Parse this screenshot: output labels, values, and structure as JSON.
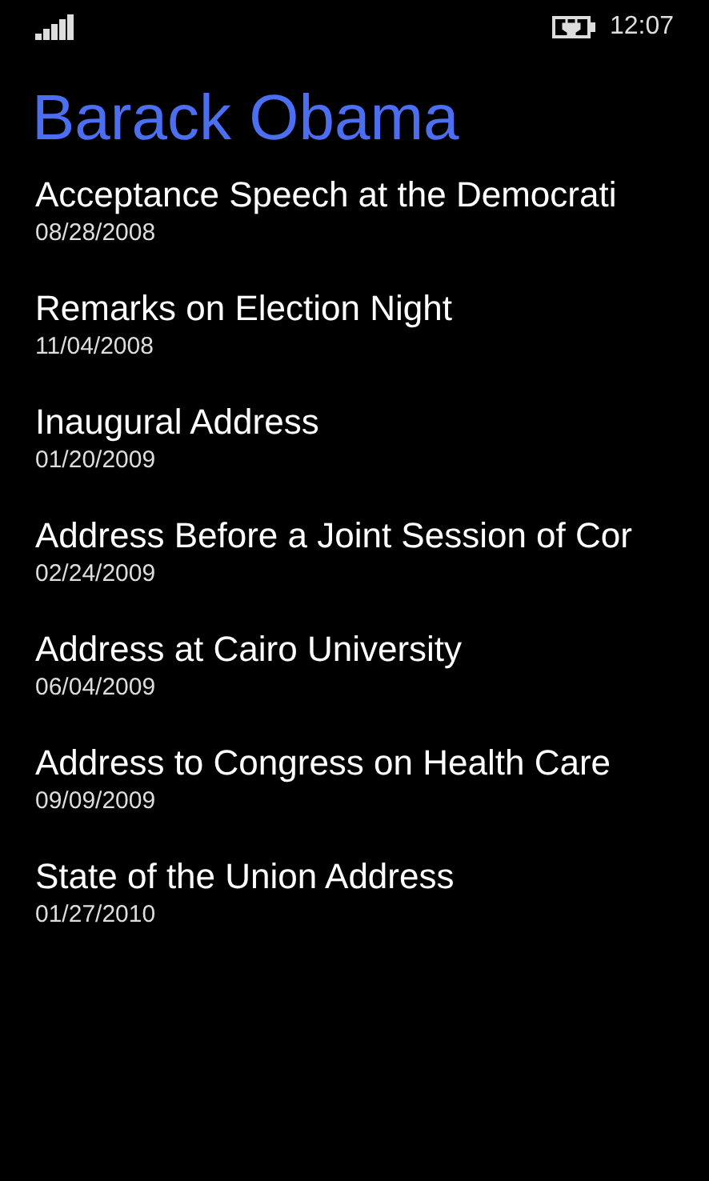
{
  "status_bar": {
    "time": "12:07"
  },
  "title": "Barack Obama",
  "speeches": [
    {
      "title": "Acceptance Speech at the Democrati",
      "date": "08/28/2008"
    },
    {
      "title": "Remarks on Election Night",
      "date": "11/04/2008"
    },
    {
      "title": "Inaugural Address",
      "date": "01/20/2009"
    },
    {
      "title": "Address Before a Joint Session of Cor",
      "date": "02/24/2009"
    },
    {
      "title": "Address at Cairo University",
      "date": "06/04/2009"
    },
    {
      "title": "Address to Congress on Health Care",
      "date": "09/09/2009"
    },
    {
      "title": "State of the Union Address",
      "date": "01/27/2010"
    }
  ]
}
